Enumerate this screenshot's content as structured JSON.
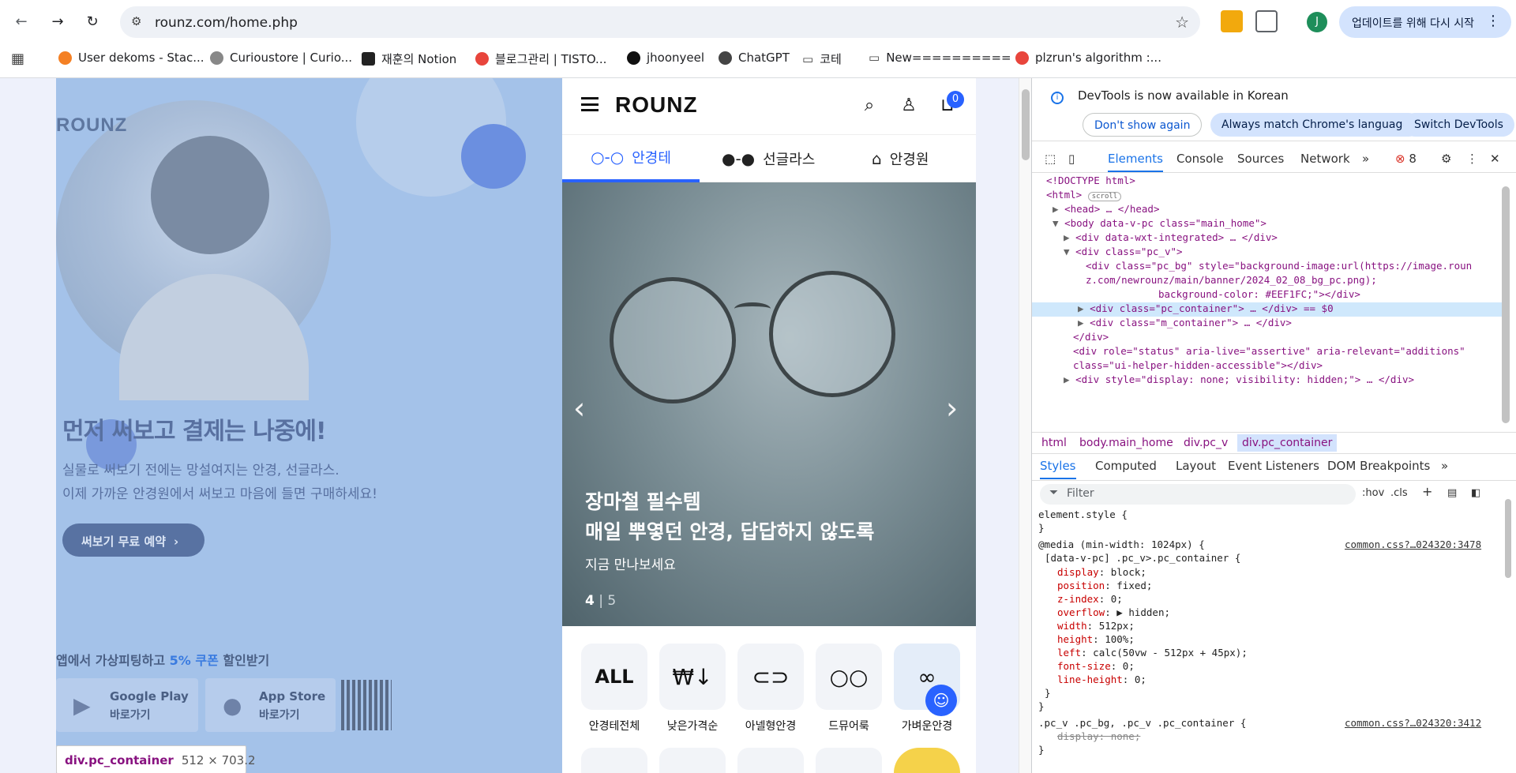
{
  "browser": {
    "url": "rounz.com/home.php",
    "update_button": "업데이트를 위해 다시 시작",
    "profile_initial": "J",
    "bookmarks": [
      "User dekoms - Stac...",
      "Curioustore | Curio...",
      "재훈의 Notion",
      "블로그관리 | TISTO...",
      "jhoonyeel",
      "ChatGPT",
      "코테",
      "New==========",
      "plzrun's algorithm :..."
    ]
  },
  "pc": {
    "logo": "ROUNZ",
    "title": "먼저 써보고 결제는 나중에!",
    "subtitle_1": "실물로 써보기 전에는 망설여지는 안경, 선글라스.",
    "subtitle_2": "이제 가까운 안경원에서 써보고 마음에 들면 구매하세요!",
    "try_button": "써보기 무료 예약",
    "app_text_pre": "앱에서 가상피팅하고 ",
    "app_text_em": "5% 쿠폰",
    "app_text_post": " 할인받기",
    "google_play": "Google Play",
    "app_store": "App Store",
    "go_label": "바로가기",
    "tooltip_tag": "div.pc_container",
    "tooltip_size": "512 × 703.2"
  },
  "mobile": {
    "logo": "ROUNZ",
    "cart_count": "0",
    "tabs": [
      "안경테",
      "선글라스",
      "안경원"
    ],
    "banner": {
      "title_1": "장마철 필수템",
      "title_2": "매일 뿌옇던 안경, 답답하지 않도록",
      "subtitle": "지금 만나보세요",
      "page_current": "4",
      "page_sep": " | ",
      "page_total": "5"
    },
    "categories": [
      {
        "icon": "ALL",
        "label": "안경테전체"
      },
      {
        "icon": "₩↓",
        "label": "낮은가격순"
      },
      {
        "icon": "⊂⊃",
        "label": "아넬형안경"
      },
      {
        "icon": "○○",
        "label": "드뮤어룩"
      },
      {
        "icon": "∞",
        "label": "가벼운안경"
      }
    ]
  },
  "devtools": {
    "banner_text": "DevTools is now available in Korean",
    "btn_dont_show": "Don't show again",
    "btn_match": "Always match Chrome's language",
    "btn_switch": "Switch DevTools",
    "tabs": [
      "Elements",
      "Console",
      "Sources",
      "Network"
    ],
    "error_count": "8",
    "dom_lines": [
      "<!DOCTYPE html>",
      "<html>",
      "<head> … </head>",
      "<body data-v-pc class=\"main_home\">",
      "<div data-wxt-integrated> … </div>",
      "<div class=\"pc_v\">",
      "<div class=\"pc_bg\" style=\"background-image:url(https://image.roun",
      "z.com/newrounz/main/banner/2024_02_08_bg_pc.png);",
      "background-color: #EEF1FC;\"></div>",
      "<div class=\"pc_container\"> … </div> == $0",
      "<div class=\"m_container\"> … </div>",
      "</div>",
      "<div role=\"status\" aria-live=\"assertive\" aria-relevant=\"additions\"",
      "class=\"ui-helper-hidden-accessible\"></div>",
      "<div style=\"display: none; visibility: hidden;\"> … </div>"
    ],
    "html_scroll_badge": "scroll",
    "breadcrumbs": [
      "html",
      "body.main_home",
      "div.pc_v",
      "div.pc_container"
    ],
    "style_tabs": [
      "Styles",
      "Computed",
      "Layout",
      "Event Listeners",
      "DOM Breakpoints"
    ],
    "filter_placeholder": "Filter",
    "hov": ":hov",
    "cls": ".cls",
    "rules": {
      "element_style": "element.style {",
      "close": "}",
      "media": "@media (min-width: 1024px) {",
      "selector_1": "[data-v-pc] .pc_v>.pc_container {",
      "source_1": "common.css?…024320:3478",
      "props_1": [
        [
          "display",
          "block;"
        ],
        [
          "position",
          "fixed;"
        ],
        [
          "z-index",
          "0;"
        ],
        [
          "overflow",
          "▶ hidden;"
        ],
        [
          "width",
          "512px;"
        ],
        [
          "height",
          "100%;"
        ],
        [
          "left",
          "calc(50vw - 512px + 45px);"
        ],
        [
          "font-size",
          "0;"
        ],
        [
          "line-height",
          "0;"
        ]
      ],
      "selector_2": ".pc_v .pc_bg, .pc_v .pc_container {",
      "source_2": "common.css?…024320:3412",
      "prop_2": "display: none;"
    }
  }
}
